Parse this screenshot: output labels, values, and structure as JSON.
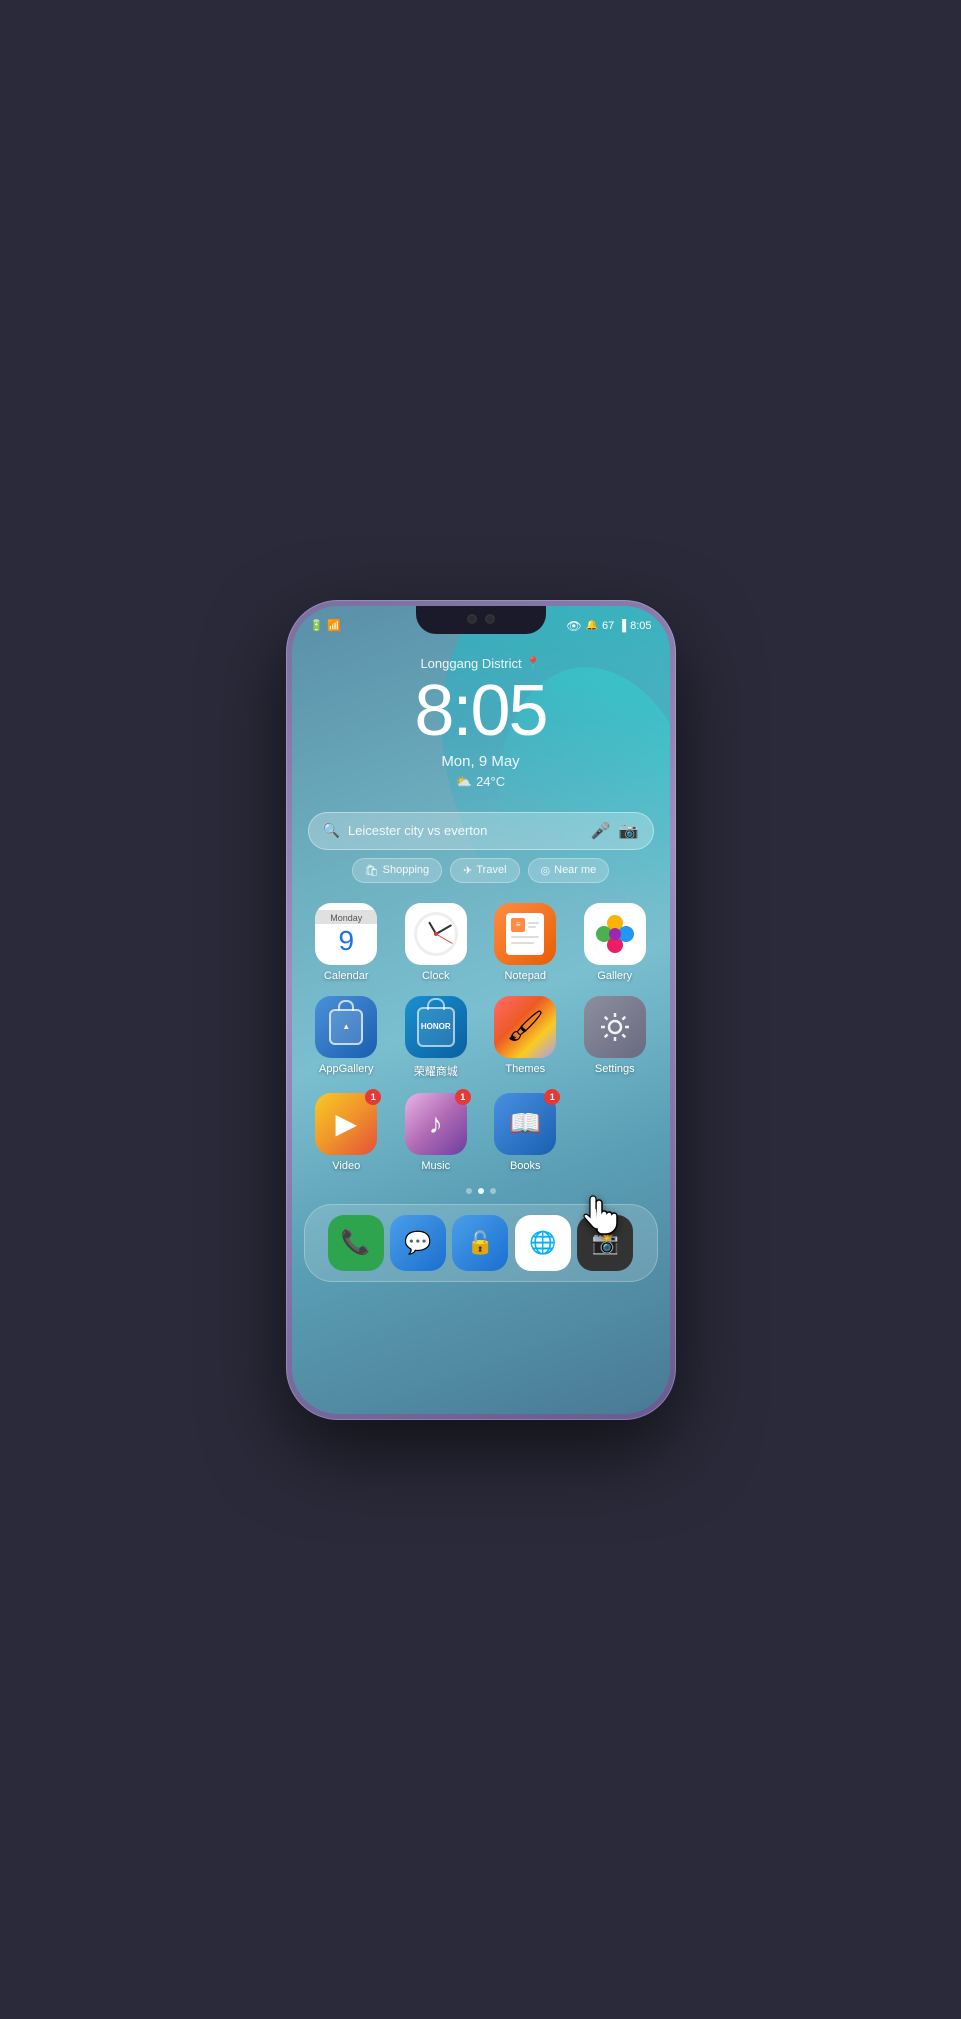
{
  "phone": {
    "status": {
      "time": "8:05",
      "battery": "67",
      "wifi": "●",
      "left_icons": [
        "battery-icon",
        "wifi-icon"
      ]
    },
    "lockscreen": {
      "location": "Longgang District",
      "time": "8:05",
      "date": "Mon, 9 May",
      "weather": "24°C"
    },
    "search": {
      "placeholder": "Leicester city vs everton",
      "quick_links": [
        "Shopping",
        "Travel",
        "Near me"
      ]
    },
    "apps_row1": [
      {
        "id": "calendar",
        "label": "Calendar",
        "type": "calendar",
        "date_num": "9",
        "day": "Monday"
      },
      {
        "id": "clock",
        "label": "Clock",
        "type": "clock"
      },
      {
        "id": "notepad",
        "label": "Notepad",
        "type": "notepad"
      },
      {
        "id": "gallery",
        "label": "Gallery",
        "type": "gallery"
      }
    ],
    "apps_row2": [
      {
        "id": "appgallery",
        "label": "AppGallery",
        "type": "appgallery"
      },
      {
        "id": "honor",
        "label": "荣耀商城",
        "type": "honor"
      },
      {
        "id": "themes",
        "label": "Themes",
        "type": "themes"
      },
      {
        "id": "settings",
        "label": "Settings",
        "type": "settings"
      }
    ],
    "apps_row3": [
      {
        "id": "video",
        "label": "Video",
        "type": "video",
        "badge": "1"
      },
      {
        "id": "music",
        "label": "Music",
        "type": "music",
        "badge": "1"
      },
      {
        "id": "books",
        "label": "Books",
        "type": "books",
        "badge": "1"
      }
    ],
    "dock": [
      {
        "id": "phone",
        "type": "phone"
      },
      {
        "id": "sms",
        "type": "sms"
      },
      {
        "id": "lock",
        "type": "lock"
      },
      {
        "id": "browser",
        "type": "browser"
      },
      {
        "id": "camera",
        "type": "camera"
      }
    ],
    "page_dots": [
      0,
      1,
      2
    ],
    "active_dot": 1
  }
}
